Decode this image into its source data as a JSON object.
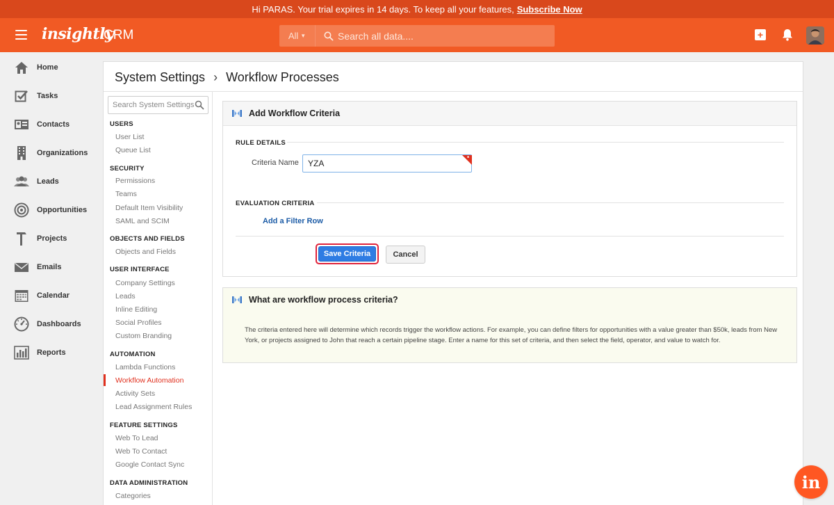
{
  "banner": {
    "message": "Hi PARAS. Your trial expires in 14 days. To keep all your features,",
    "link": "Subscribe Now"
  },
  "header": {
    "logo": "insightly",
    "product": "CRM",
    "search_scope": "All",
    "search_placeholder": "Search all data....",
    "add_label": "+"
  },
  "nav": {
    "items": [
      {
        "label": "Home",
        "icon": "home-icon"
      },
      {
        "label": "Tasks",
        "icon": "tasks-icon"
      },
      {
        "label": "Contacts",
        "icon": "contacts-icon"
      },
      {
        "label": "Organizations",
        "icon": "organizations-icon"
      },
      {
        "label": "Leads",
        "icon": "leads-icon"
      },
      {
        "label": "Opportunities",
        "icon": "opportunities-icon"
      },
      {
        "label": "Projects",
        "icon": "projects-icon"
      },
      {
        "label": "Emails",
        "icon": "emails-icon"
      },
      {
        "label": "Calendar",
        "icon": "calendar-icon"
      },
      {
        "label": "Dashboards",
        "icon": "dashboards-icon"
      },
      {
        "label": "Reports",
        "icon": "reports-icon"
      }
    ]
  },
  "breadcrumb": {
    "parent": "System Settings",
    "separator": "›",
    "current": "Workflow Processes"
  },
  "settings": {
    "search_placeholder": "Search System Settings",
    "groups": [
      {
        "heading": "USERS",
        "links": [
          "User List",
          "Queue List"
        ]
      },
      {
        "heading": "SECURITY",
        "links": [
          "Permissions",
          "Teams",
          "Default Item Visibility",
          "SAML and SCIM"
        ]
      },
      {
        "heading": "OBJECTS AND FIELDS",
        "links": [
          "Objects and Fields"
        ]
      },
      {
        "heading": "USER INTERFACE",
        "links": [
          "Company Settings",
          "Leads",
          "Inline Editing",
          "Social Profiles",
          "Custom Branding"
        ]
      },
      {
        "heading": "AUTOMATION",
        "links": [
          "Lambda Functions",
          "Workflow Automation",
          "Activity Sets",
          "Lead Assignment Rules"
        ]
      },
      {
        "heading": "FEATURE SETTINGS",
        "links": [
          "Web To Lead",
          "Web To Contact",
          "Google Contact Sync"
        ]
      },
      {
        "heading": "DATA ADMINISTRATION",
        "links": [
          "Categories"
        ]
      }
    ],
    "active_link": "Workflow Automation"
  },
  "criteria_card": {
    "title": "Add Workflow Criteria",
    "rule_details_heading": "RULE DETAILS",
    "criteria_name_label": "Criteria Name",
    "criteria_name_value": "YZA",
    "required_mark": "*",
    "evaluation_heading": "EVALUATION CRITERIA",
    "add_filter_link": "Add a Filter Row",
    "save_label": "Save Criteria",
    "cancel_label": "Cancel"
  },
  "info_card": {
    "title": "What are workflow process criteria?",
    "body": "The criteria entered here will determine which records trigger the workflow actions. For example, you can define filters for opportunities with a value greater than $50k, leads from New York, or projects assigned to John that reach a certain pipeline stage. Enter a name for this set of criteria, and then select the field, operator, and value to watch for."
  },
  "badge": {
    "label": "in"
  },
  "colors": {
    "brand_orange": "#f15a24",
    "banner_red": "#d9481c",
    "active_red": "#e0301e",
    "link_blue": "#1b5ba6",
    "button_blue": "#2e7ce3"
  }
}
